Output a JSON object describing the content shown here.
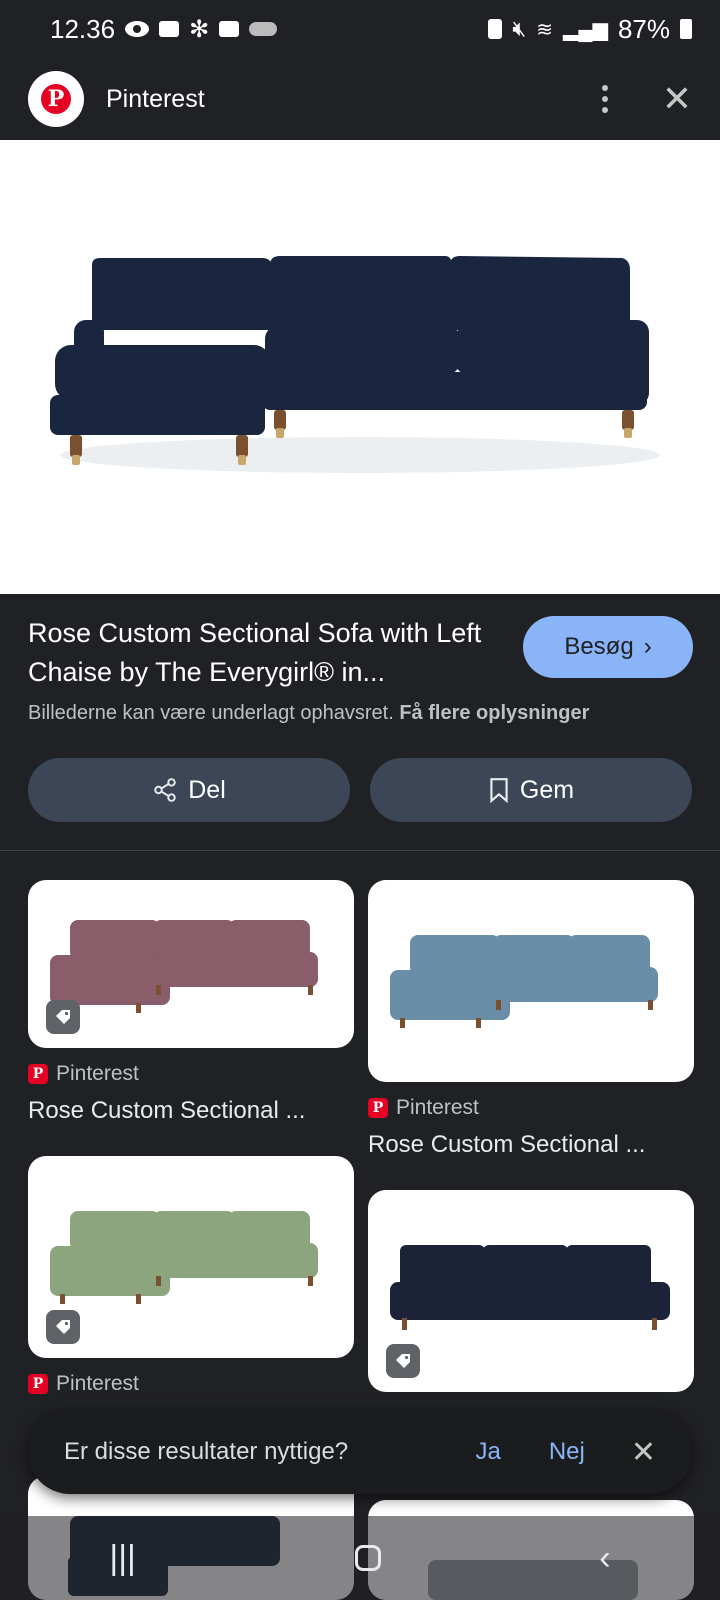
{
  "status_bar": {
    "time": "12.36",
    "battery": "87%"
  },
  "header": {
    "title": "Pinterest",
    "logo_letter": "P"
  },
  "product": {
    "title": "Rose Custom Sectional Sofa with Left Chaise by The Everygirl® in...",
    "visit_label": "Besøg",
    "copyright_text": "Billederne kan være underlagt ophavsret.",
    "more_info_label": "Få flere oplysninger",
    "sofa_color": "#1a2540"
  },
  "actions": {
    "share_label": "Del",
    "save_label": "Gem"
  },
  "results": [
    {
      "source": "Pinterest",
      "title": "Rose Custom Sectional ...",
      "sofa_color": "#8a5d6a"
    },
    {
      "source": "Pinterest",
      "title": "Rose Custom Sectional ...",
      "sofa_color": "#6a8ea8"
    },
    {
      "source": "Pinterest",
      "title": "",
      "sofa_color": "#8ca57f"
    },
    {
      "source": "",
      "title": "",
      "sofa_color": "#1c2338"
    }
  ],
  "feedback": {
    "question": "Er disse resultater nyttige?",
    "yes_label": "Ja",
    "no_label": "Nej"
  },
  "colors": {
    "accent": "#8ab4f8",
    "pinterest_red": "#e60023",
    "background": "#202124"
  }
}
